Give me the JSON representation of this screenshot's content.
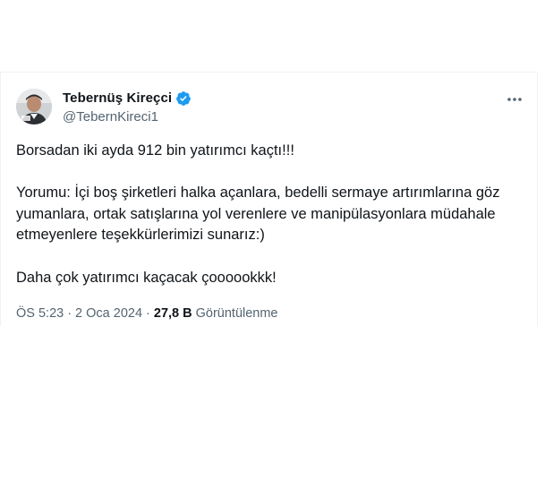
{
  "tweet": {
    "author": {
      "display_name": "Tebernüş Kireçci",
      "handle": "@TebernKireci1",
      "verified": true,
      "verified_color": "#1d9bf0"
    },
    "body": {
      "line1": "Borsadan iki ayda 912 bin yatırımcı kaçtı!!!",
      "line2": "Yorumu: İçi boş şirketleri halka açanlara, bedelli sermaye artırımlarına göz yumanlara, ortak satışlarına yol verenlere ve manipülasyonlara müdahale etmeyenlere teşekkürlerimizi sunarız:)",
      "line3": "Daha çok yatırımcı kaçacak çoooookkk!"
    },
    "meta": {
      "time": "ÖS 5:23",
      "separator": "·",
      "date": "2 Oca 2024",
      "views_count": "27,8 B",
      "views_label": "Görüntülenme"
    }
  },
  "icons": {
    "more": "more-horizontal-icon",
    "verified": "verified-badge-icon"
  },
  "colors": {
    "text_primary": "#0f1419",
    "text_secondary": "#536471",
    "border": "#eff3f4"
  }
}
